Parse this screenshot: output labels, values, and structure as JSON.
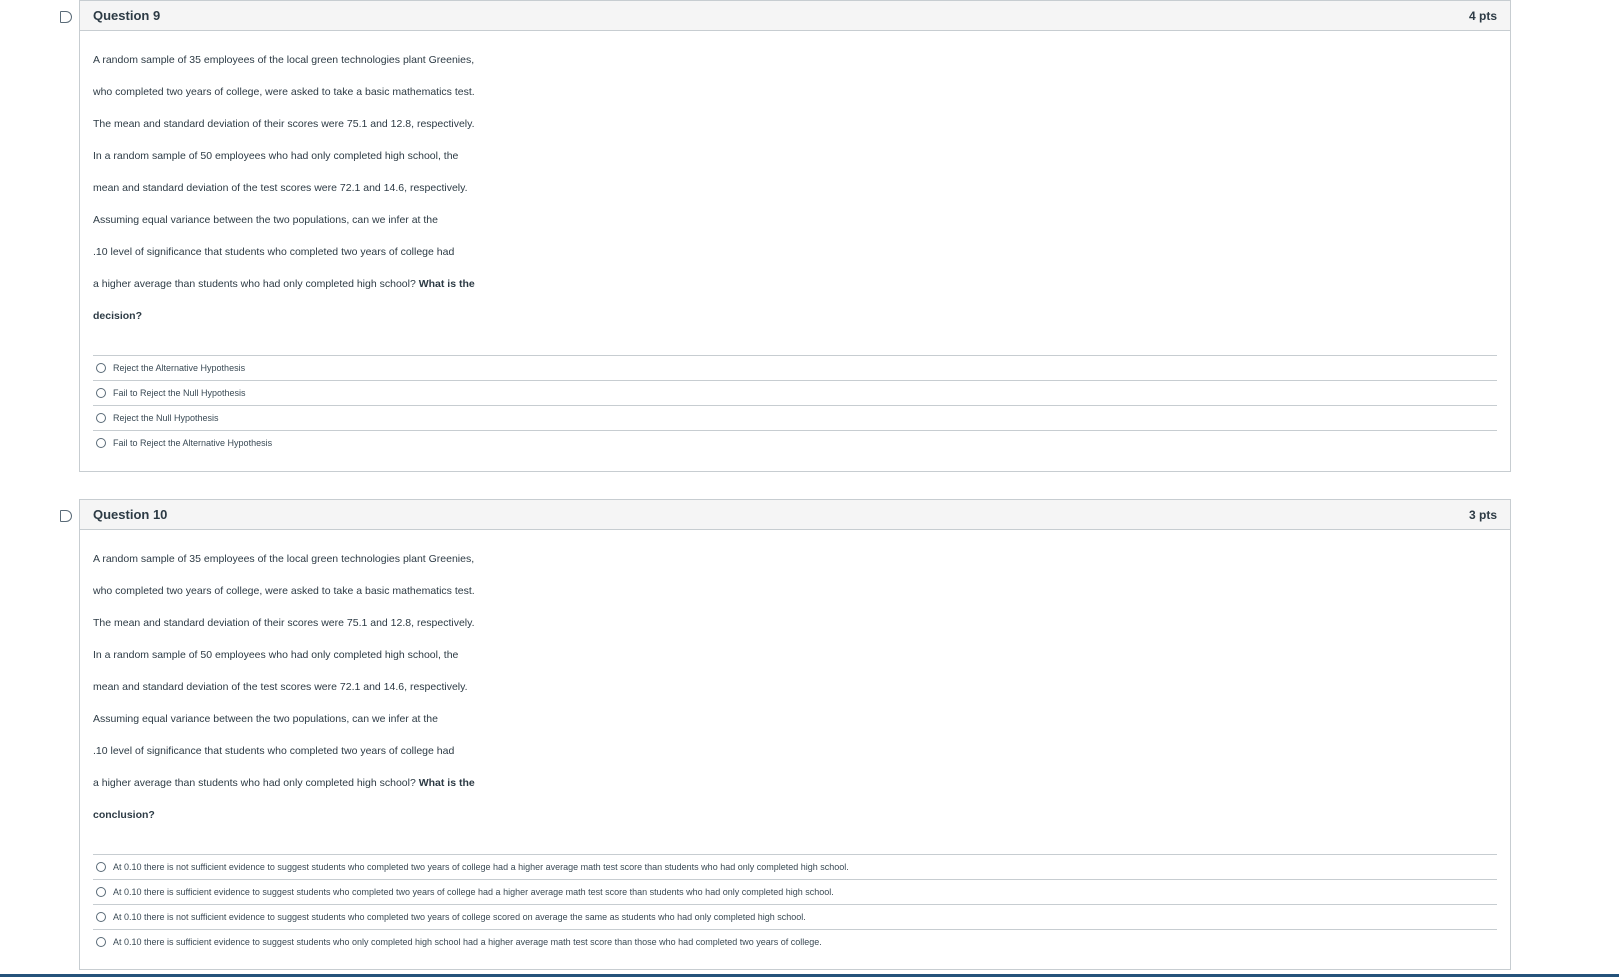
{
  "questions": [
    {
      "title": "Question 9",
      "points": "4 pts",
      "text_lines": [
        "A random sample of 35 employees of the local green technologies plant Greenies,",
        "who completed two years of college, were asked to take a basic mathematics test.",
        "The mean and standard deviation of their scores were 75.1 and 12.8, respectively.",
        "In a random sample of 50 employees who had only completed high school, the",
        "mean and standard deviation of the test scores were 72.1 and 14.6, respectively.",
        "Assuming equal variance between the two populations, can we infer at the",
        ".10 level of significance that students who completed two years of college had"
      ],
      "last_line_plain": "a higher average than students who had only completed high school? ",
      "last_line_bold": "What is the",
      "bold_tail": "decision?",
      "answers": [
        "Reject the Alternative Hypothesis",
        "Fail to Reject the Null Hypothesis",
        "Reject the Null Hypothesis",
        "Fail to Reject the Alternative Hypothesis"
      ]
    },
    {
      "title": "Question 10",
      "points": "3 pts",
      "text_lines": [
        "A random sample of 35 employees of the local green technologies plant Greenies,",
        "who completed two years of college, were asked to take a basic mathematics test.",
        "The mean and standard deviation of their scores were 75.1 and 12.8, respectively.",
        "In a random sample of 50 employees who had only completed high school, the",
        "mean and standard deviation of the test scores were 72.1 and 14.6, respectively.",
        "Assuming equal variance between the two populations, can we infer at the",
        ".10 level of significance that students who completed two years of college had"
      ],
      "last_line_plain": "a higher average than students who had only completed high school? ",
      "last_line_bold": "What is the",
      "bold_tail": "conclusion?",
      "answers": [
        "At 0.10 there is not sufficient evidence to suggest students who completed two years of college had a higher average math test score than students who had only completed high school.",
        "At 0.10 there is sufficient evidence to suggest students who completed two years of college had a higher average math test score than students who had only completed high school.",
        "At 0.10 there is not sufficient evidence to suggest students who completed two years of college scored on average the same as students who had only completed high school.",
        "At 0.10 there is sufficient evidence to suggest students who only completed high school had a higher average math test score than those who had completed two years of college."
      ]
    }
  ]
}
